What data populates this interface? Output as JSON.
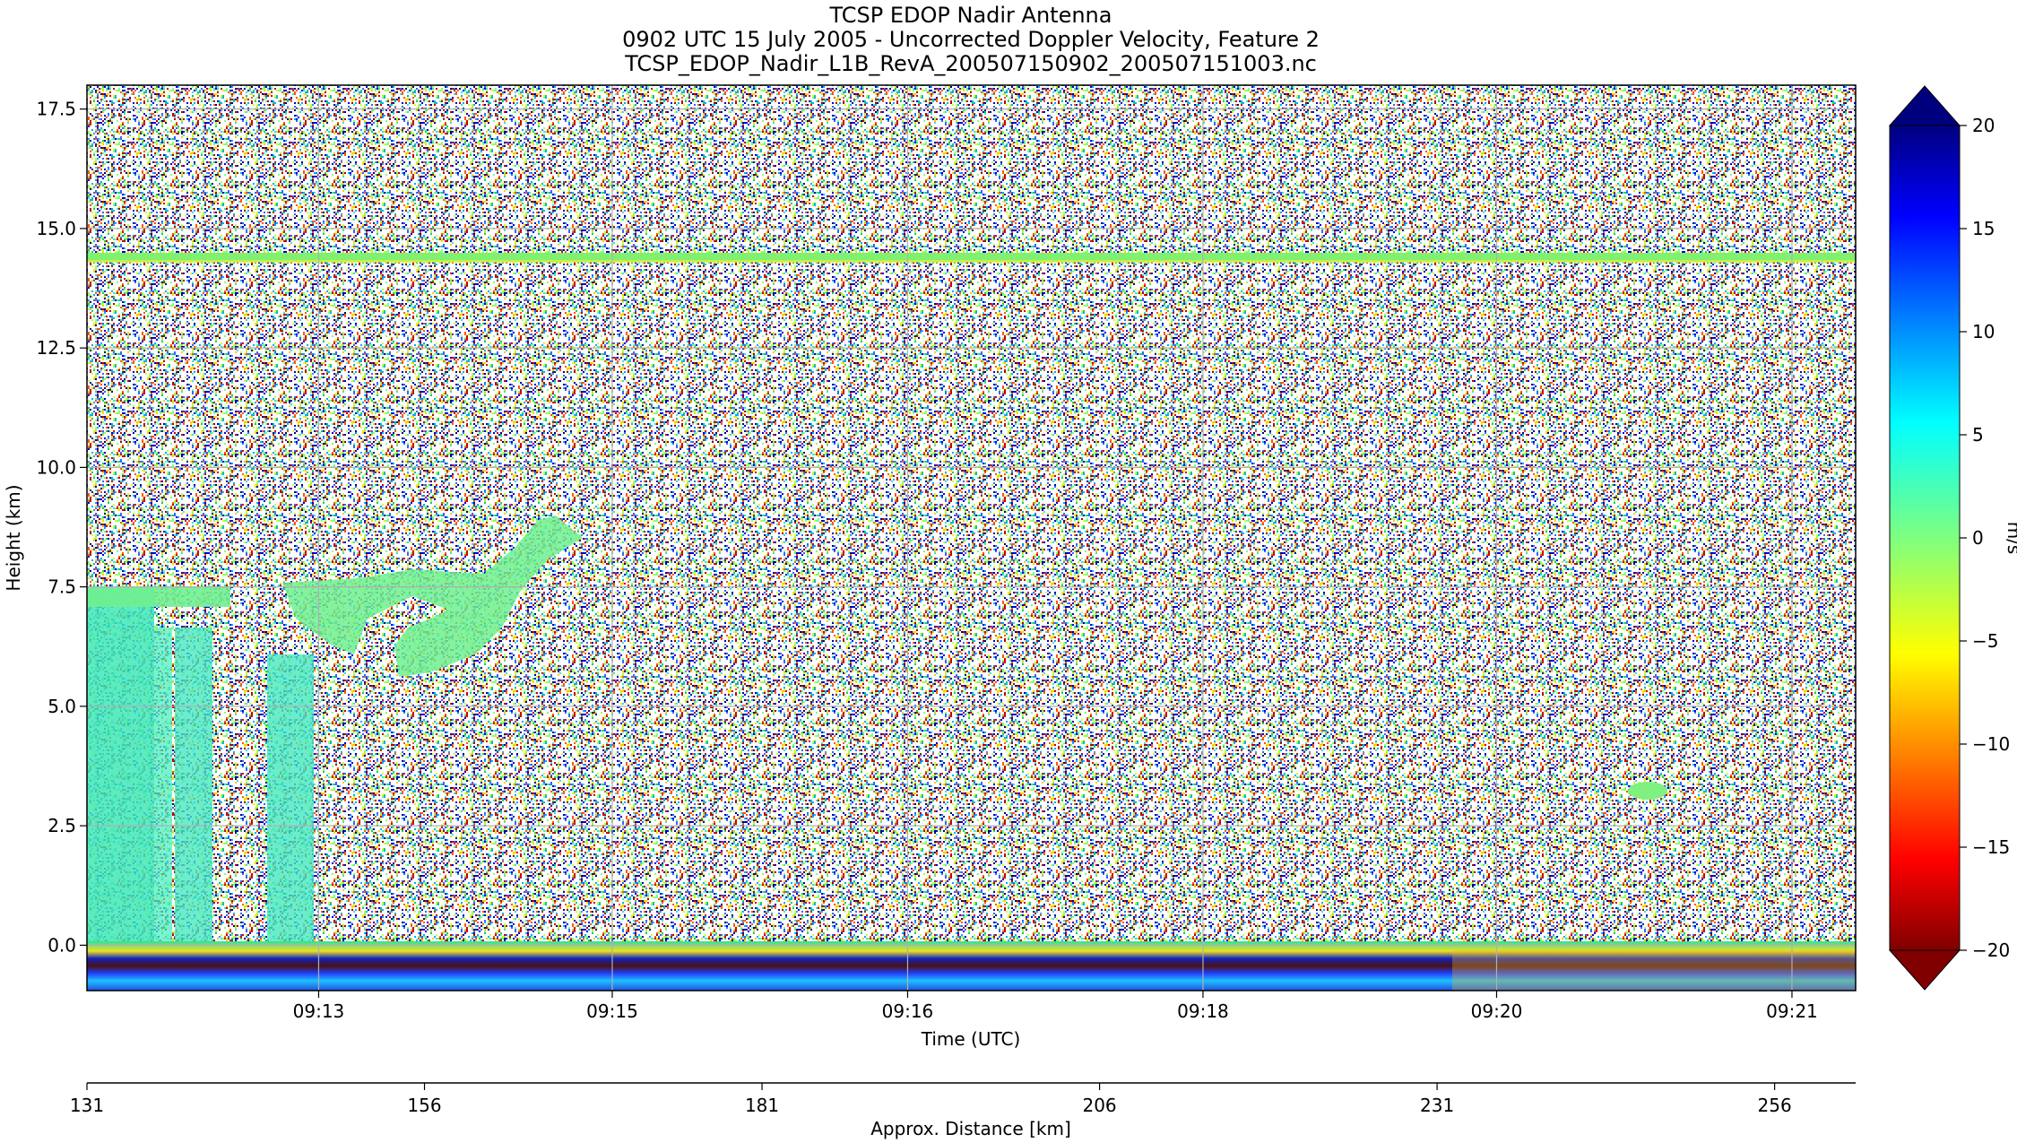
{
  "chart_data": {
    "type": "heatmap",
    "title_lines": [
      "TCSP EDOP Nadir Antenna",
      "0902 UTC 15 July 2005 - Uncorrected Doppler Velocity, Feature 2",
      "TCSP_EDOP_Nadir_L1B_RevA_200507150902_200507151003.nc"
    ],
    "xlabel": "Time (UTC)",
    "ylabel": "Height (km)",
    "x2label": "Approx. Distance [km]",
    "ylim": [
      -0.95,
      18.0
    ],
    "y_ticks": [
      -0.0,
      2.5,
      5.0,
      7.5,
      10.0,
      12.5,
      15.0,
      17.5
    ],
    "y_tick_labels": [
      "0.0",
      "2.5",
      "5.0",
      "7.5",
      "10.0",
      "12.5",
      "15.0",
      "17.5"
    ],
    "x_time_ticks": [
      {
        "label": "09:13",
        "frac": 0.131
      },
      {
        "label": "09:15",
        "frac": 0.297
      },
      {
        "label": "09:16",
        "frac": 0.464
      },
      {
        "label": "09:18",
        "frac": 0.631
      },
      {
        "label": "09:20",
        "frac": 0.797
      },
      {
        "label": "09:21",
        "frac": 0.964
      }
    ],
    "distance_range": [
      131,
      262
    ],
    "distance_ticks": [
      131,
      156,
      181,
      206,
      231,
      256
    ],
    "colorbar": {
      "label": "m/s",
      "colormap": "jet_r",
      "vmin": -20,
      "vmax": 20,
      "ticks": [
        20,
        15,
        10,
        5,
        0,
        -5,
        -10,
        -15,
        -20
      ],
      "tick_labels": [
        "20",
        "15",
        "10",
        "5",
        "0",
        "−5",
        "−10",
        "−15",
        "−20"
      ],
      "extend": "both"
    },
    "features": [
      {
        "name": "tropopause-echo",
        "height_km": 14.4,
        "velocity_ms": -1
      },
      {
        "name": "surface-echo",
        "height_km": -0.5,
        "velocity_ms": 10
      },
      {
        "name": "convective-cloud",
        "x_frac": [
          0,
          0.14
        ],
        "height_km": [
          0,
          7.5
        ],
        "velocity_ms": 4
      },
      {
        "name": "anvil-outflow",
        "x_frac": [
          0.11,
          0.29
        ],
        "height_km": [
          5.5,
          8.8
        ],
        "velocity_ms": 2
      }
    ],
    "grid": true
  }
}
